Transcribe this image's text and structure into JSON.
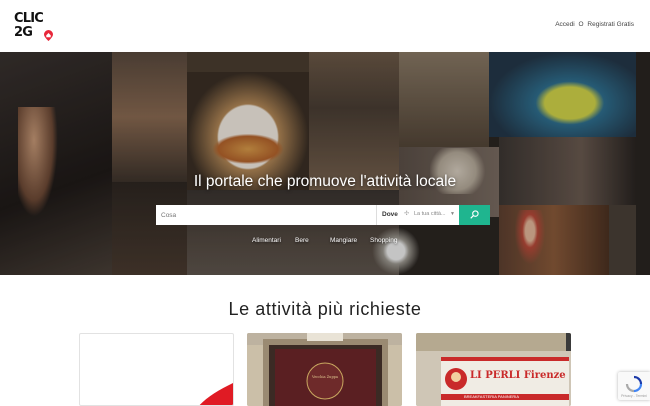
{
  "logo": {
    "line1": "CLIC",
    "line2": "2G"
  },
  "header": {
    "links": [
      {
        "label": "Accedi"
      },
      {
        "label": "O"
      },
      {
        "label": "Registrati Gratis"
      }
    ]
  },
  "hero": {
    "tagline": "Il portale che promuove l'attività locale",
    "search": {
      "placeholder": "Cosa",
      "value": "Cosa",
      "where_label": "Dove",
      "city_placeholder": "La tua città..."
    },
    "categories": [
      {
        "label": "Alimentari"
      },
      {
        "label": "Bere"
      },
      {
        "label": "Mangiare"
      },
      {
        "label": "Shopping"
      }
    ]
  },
  "section": {
    "title": "Le attività più richieste"
  },
  "cards": {
    "card2": {
      "sign_text": "Vecchia Zuppa"
    },
    "card3": {
      "sign_text": "LI PERLI Firenze",
      "sub_text": "BREAKFASTERIA PANINERIA"
    }
  },
  "colors": {
    "accent": "#1fb58f",
    "logo_red": "#e8273a",
    "text_dark": "#222222"
  },
  "icons": {
    "search_button": "search-icon",
    "location": "location-icon",
    "dropdown": "chevron-down-icon",
    "recaptcha": "recaptcha-icon"
  },
  "recaptcha": {
    "label": "Privacy - Termini"
  }
}
